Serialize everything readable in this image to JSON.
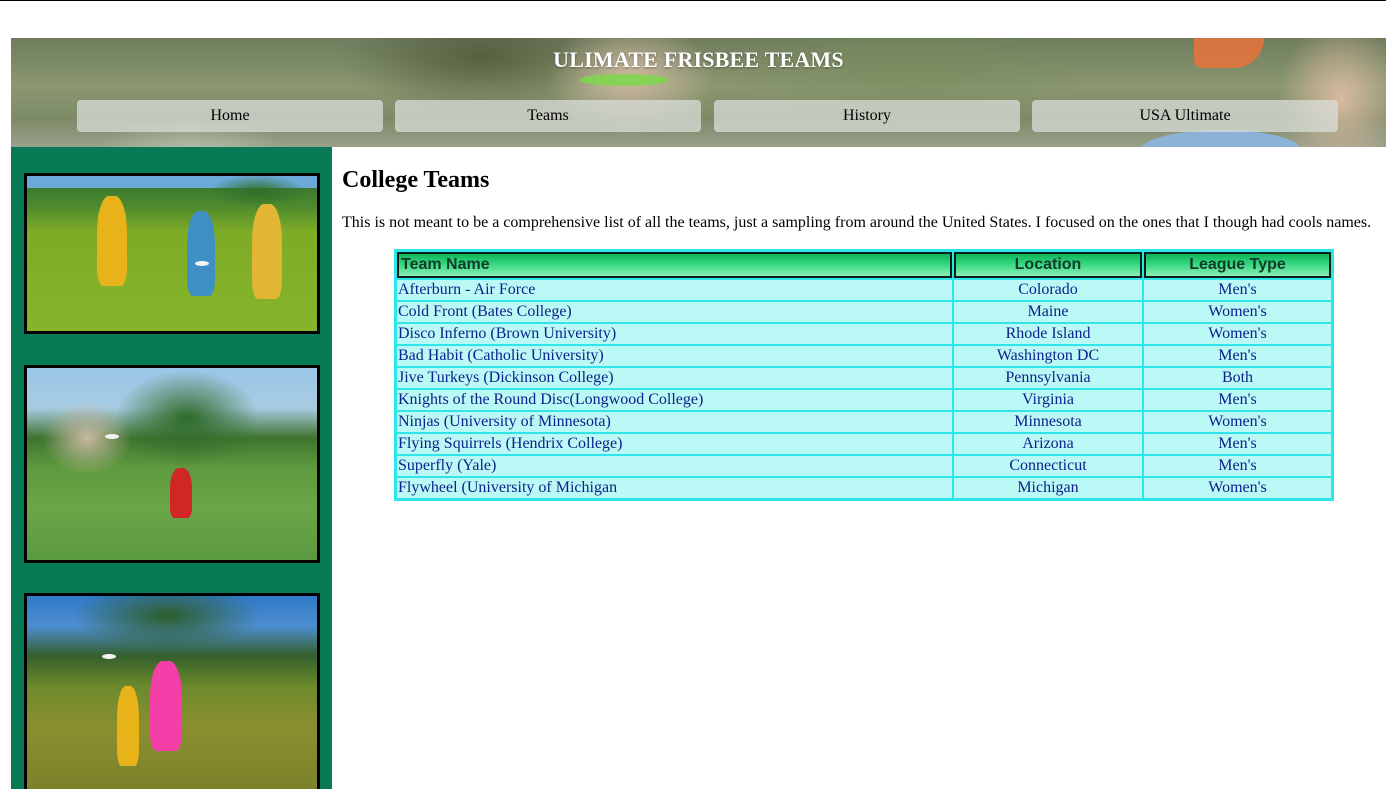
{
  "header": {
    "title": "ULIMATE FRISBEE TEAMS",
    "nav": [
      "Home",
      "Teams",
      "History",
      "USA Ultimate"
    ]
  },
  "main": {
    "heading": "College Teams",
    "intro": "This is not meant to be a comprehensive list of all the teams, just a sampling from around the United States. I focused on the ones that I though had cools names.",
    "table": {
      "headers": [
        "Team Name",
        "Location",
        "League Type"
      ],
      "rows": [
        [
          "Afterburn - Air Force",
          "Colorado",
          "Men's"
        ],
        [
          "Cold Front (Bates College)",
          "Maine",
          "Women's"
        ],
        [
          "Disco Inferno (Brown University)",
          "Rhode Island",
          "Women's"
        ],
        [
          "Bad Habit (Catholic University)",
          "Washington DC",
          "Men's"
        ],
        [
          "Jive Turkeys (Dickinson College)",
          "Pennsylvania",
          "Both"
        ],
        [
          "Knights of the Round Disc(Longwood College)",
          "Virginia",
          "Men's"
        ],
        [
          "Ninjas (University of Minnesota)",
          "Minnesota",
          "Women's"
        ],
        [
          "Flying Squirrels (Hendrix College)",
          "Arizona",
          "Men's"
        ],
        [
          "Superfly (Yale)",
          "Connecticut",
          "Men's"
        ],
        [
          "Flywheel (University of Michigan",
          "Michigan",
          "Women's"
        ]
      ]
    }
  },
  "colors": {
    "sidebar": "#087a55",
    "table_border": "#2ee6ea",
    "table_cell": "#baf9f6",
    "table_text": "#0d1f8a",
    "header_gradient_top": "#0fb55b",
    "header_gradient_bottom": "#8af0b8"
  }
}
